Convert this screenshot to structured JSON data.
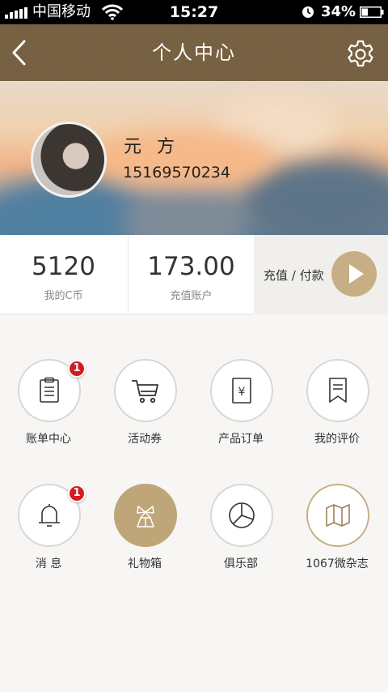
{
  "status_bar": {
    "carrier": "中国移动",
    "time": "15:27",
    "battery_percent": "34%",
    "battery_level": 0.34,
    "icons": [
      "signal-icon",
      "wifi-icon",
      "alarm-clock-icon",
      "battery-icon"
    ]
  },
  "nav": {
    "title": "个人中心",
    "back_icon": "chevron-left-icon",
    "settings_icon": "gear-icon"
  },
  "profile": {
    "name": "元 方",
    "phone": "15169570234"
  },
  "stats": [
    {
      "value": "5120",
      "label": "我的C币"
    },
    {
      "value": "173.00",
      "label": "充值账户"
    }
  ],
  "recharge": {
    "label": "充值 / 付款",
    "icon": "play-icon"
  },
  "menu": [
    {
      "label": "账单中心",
      "icon": "clipboard-icon",
      "badge": "1"
    },
    {
      "label": "活动券",
      "icon": "cart-icon"
    },
    {
      "label": "产品订单",
      "icon": "yen-order-icon"
    },
    {
      "label": "我的评价",
      "icon": "bookmark-icon"
    },
    {
      "label": "消 息",
      "icon": "bell-icon",
      "badge": "1"
    },
    {
      "label": "礼物箱",
      "icon": "gift-icon"
    },
    {
      "label": "俱乐部",
      "icon": "pie-chart-icon"
    },
    {
      "label": "1067微杂志",
      "icon": "map-icon"
    }
  ],
  "colors": {
    "nav_bg": "#7a6445",
    "accent_gold": "#c8ae84",
    "badge_red": "#d31b22",
    "page_bg": "#f7f6f4"
  }
}
